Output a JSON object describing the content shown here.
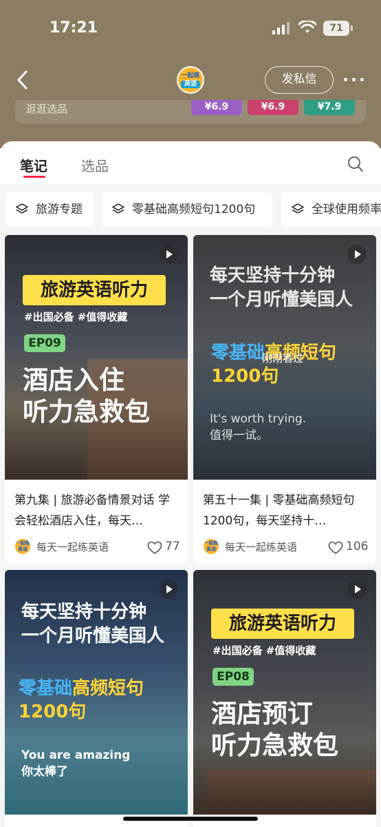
{
  "status_bar": {
    "time": "17:21",
    "battery": "71"
  },
  "header": {
    "logo_line1": "一起练",
    "logo_line2": "英语",
    "message_button": "发私信",
    "shop_label": "逛逛选品",
    "shop_prices": [
      "¥6.9",
      "¥6.9",
      "¥7.9"
    ]
  },
  "tabs": {
    "notes": "笔记",
    "select": "选品"
  },
  "collections": [
    "旅游专题",
    "零基础高频短句1200句",
    "全球使用频率"
  ],
  "cards": [
    {
      "banner": "旅游英语听力",
      "tags": "#出国必备 #值得收藏",
      "episode": "EP09",
      "big": "酒店入住\n听力急救包",
      "text": "第九集 | 旅游必备情景对话 学会轻松酒店入住，每天…",
      "author": "每天一起练英语",
      "likes": "77"
    },
    {
      "title": "每天坚持十分钟\n一个月听懂美国人",
      "sub_blue": "零基础",
      "sub_rest": "高频短句",
      "sub_line2": "1200句",
      "en": "It's worth trying.",
      "zh": "值得一试。",
      "watched": "刚刚看过",
      "text": "第五十一集 | 零基础高频短句1200句，每天坚持十…",
      "author": "每天一起练英语",
      "likes": "106"
    },
    {
      "title": "每天坚持十分钟\n一个月听懂美国人",
      "sub_blue": "零基础",
      "sub_rest": "高频短句",
      "sub_line2": "1200句",
      "en": "You are amazing",
      "zh": "你太棒了"
    },
    {
      "banner": "旅游英语听力",
      "tags": "#出国必备 #值得收藏",
      "episode": "EP08",
      "big": "酒店预订\n听力急救包"
    }
  ],
  "colors": {
    "header_bg": "#8a7d63",
    "accent": "#ff2442",
    "banner_yellow": "#ffe04a"
  }
}
